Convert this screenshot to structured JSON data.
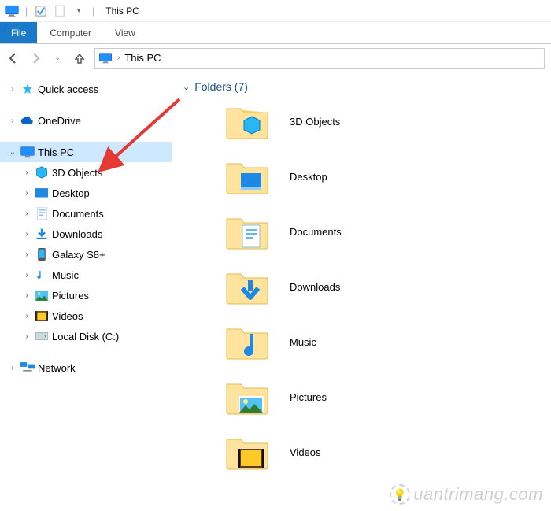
{
  "titlebar": {
    "title": "This PC"
  },
  "tabs": {
    "file": "File",
    "computer": "Computer",
    "view": "View"
  },
  "address": {
    "location": "This PC"
  },
  "sidebar": {
    "quick_access": "Quick access",
    "onedrive": "OneDrive",
    "this_pc": "This PC",
    "children": [
      {
        "label": "3D Objects"
      },
      {
        "label": "Desktop"
      },
      {
        "label": "Documents"
      },
      {
        "label": "Downloads"
      },
      {
        "label": "Galaxy S8+"
      },
      {
        "label": "Music"
      },
      {
        "label": "Pictures"
      },
      {
        "label": "Videos"
      },
      {
        "label": "Local Disk (C:)"
      }
    ],
    "network": "Network"
  },
  "content": {
    "group_label": "Folders (7)",
    "items": [
      {
        "label": "3D Objects"
      },
      {
        "label": "Desktop"
      },
      {
        "label": "Documents"
      },
      {
        "label": "Downloads"
      },
      {
        "label": "Music"
      },
      {
        "label": "Pictures"
      },
      {
        "label": "Videos"
      }
    ]
  },
  "watermark": "uantrimang.com"
}
